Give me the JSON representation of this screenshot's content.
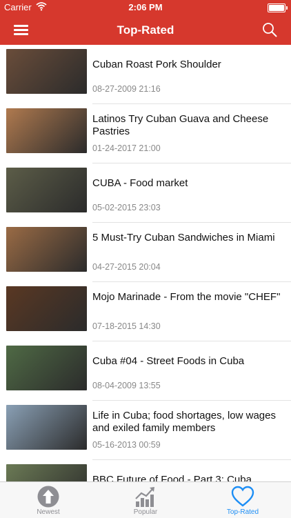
{
  "status_bar": {
    "carrier": "Carrier",
    "time": "2:06 PM",
    "battery_level": 1.0
  },
  "nav": {
    "title": "Top-Rated",
    "menu_icon": "hamburger-menu-icon",
    "search_icon": "search-icon"
  },
  "videos": [
    {
      "title": "Cuban Roast Pork Shoulder",
      "date": "08-27-2009 21:16",
      "thumb_color": "#6a4d3a"
    },
    {
      "title": "Latinos Try Cuban Guava and Cheese Pastries",
      "date": "01-24-2017 21:00",
      "thumb_color": "#b07a4f"
    },
    {
      "title": "CUBA - Food market",
      "date": "05-02-2015 23:03",
      "thumb_color": "#5c5d48"
    },
    {
      "title": "5 Must-Try Cuban Sandwiches in Miami",
      "date": "04-27-2015 20:04",
      "thumb_color": "#9a6b45"
    },
    {
      "title": "Mojo Marinade - From the movie \"CHEF\"",
      "date": "07-18-2015 14:30",
      "thumb_color": "#5a3823"
    },
    {
      "title": "Cuba #04 - Street Foods in Cuba",
      "date": "08-04-2009 13:55",
      "thumb_color": "#4f6a45"
    },
    {
      "title": "Life in Cuba; food shortages, low wages and exiled family members",
      "date": "05-16-2013 00:59",
      "thumb_color": "#8aa0b5"
    },
    {
      "title": "BBC Future of Food - Part 3: Cuba",
      "date": "",
      "thumb_color": "#6b7a55"
    }
  ],
  "tabs": [
    {
      "label": "Newest",
      "icon": "arrow-up-circle-icon"
    },
    {
      "label": "Popular",
      "icon": "trend-chart-icon"
    },
    {
      "label": "Top-Rated",
      "icon": "heart-icon"
    }
  ],
  "colors": {
    "accent": "#d6382d",
    "tab_active": "#1d8ef5",
    "tab_inactive": "#8e8e93"
  }
}
